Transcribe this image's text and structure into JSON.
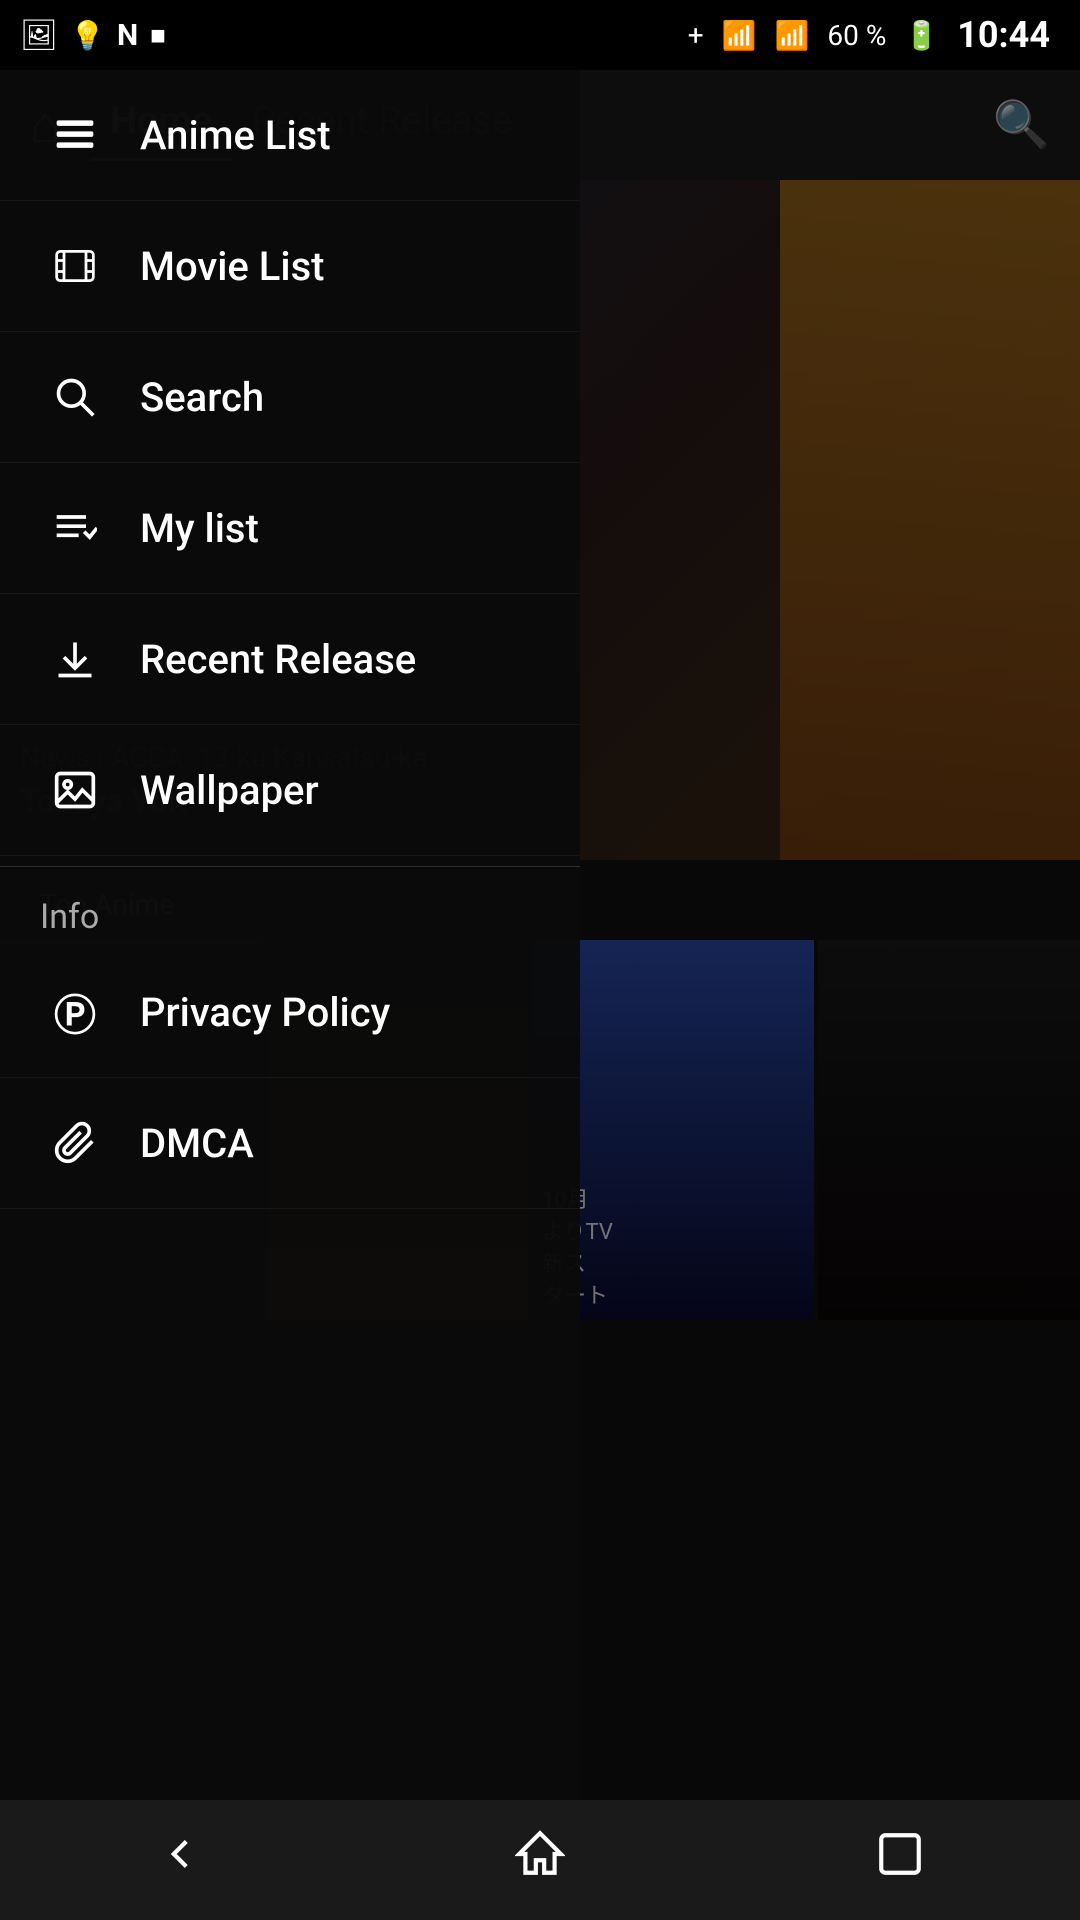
{
  "statusBar": {
    "time": "10:44",
    "battery": "60 %",
    "icons": [
      "bluetooth",
      "wifi",
      "signal"
    ]
  },
  "header": {
    "tabs": [
      {
        "label": "Home",
        "active": true
      },
      {
        "label": "Recent Release",
        "active": false
      }
    ],
    "searchLabel": "search"
  },
  "drawer": {
    "items": [
      {
        "id": "anime-list",
        "label": "Anime List",
        "icon": "list"
      },
      {
        "id": "movie-list",
        "label": "Movie List",
        "icon": "film"
      },
      {
        "id": "search",
        "label": "Search",
        "icon": "search"
      },
      {
        "id": "my-list",
        "label": "My list",
        "icon": "mylist"
      },
      {
        "id": "recent-release",
        "label": "Recent Release",
        "icon": "download"
      },
      {
        "id": "wallpaper",
        "label": "Wallpaper",
        "icon": "wallpaper"
      }
    ],
    "infoSection": {
      "label": "Info",
      "items": [
        {
          "id": "privacy-policy",
          "label": "Privacy Policy",
          "icon": "privacy"
        },
        {
          "id": "dmca",
          "label": "DMCA",
          "icon": "dmca"
        }
      ]
    }
  },
  "hero": {
    "textLine1": "News : ACCA: 13-ku Kansatsu-ka",
    "textLine2": "Tobaya Yori"
  },
  "topAnimeBadge": "Top Anime",
  "navBar": {
    "back": "◁",
    "home": "△",
    "recent": "□"
  }
}
